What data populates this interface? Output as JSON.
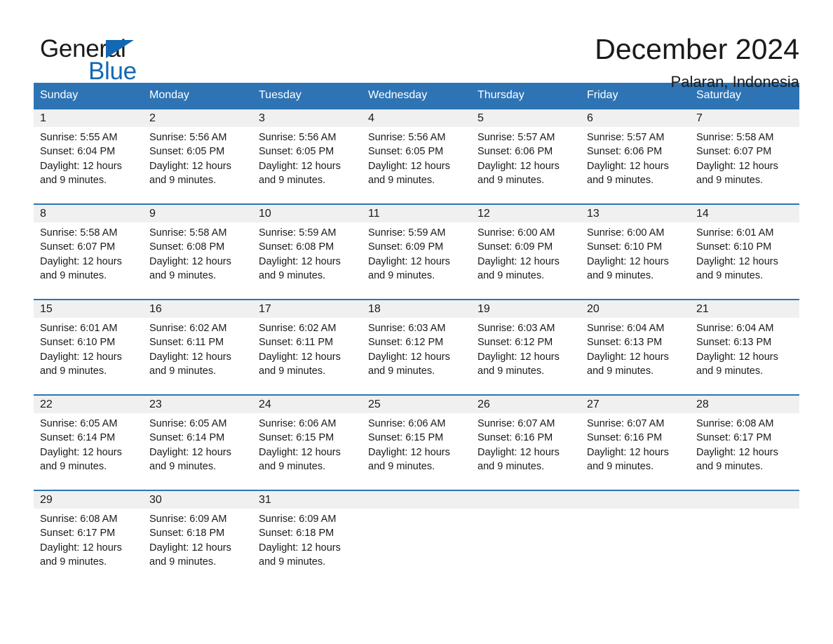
{
  "brand": {
    "name_part1": "General",
    "name_part2": "Blue",
    "logo_icon": "triangle-flag-icon"
  },
  "header": {
    "month_title": "December 2024",
    "location": "Palaran, Indonesia"
  },
  "colors": {
    "header_blue": "#2e74b5",
    "brand_blue": "#1268b3",
    "daynum_band": "#f0f0f0",
    "text": "#1a1a1a"
  },
  "calendar": {
    "weekday_headers": [
      "Sunday",
      "Monday",
      "Tuesday",
      "Wednesday",
      "Thursday",
      "Friday",
      "Saturday"
    ],
    "weeks": [
      [
        {
          "day": "1",
          "sunrise": "Sunrise: 5:55 AM",
          "sunset": "Sunset: 6:04 PM",
          "daylight1": "Daylight: 12 hours",
          "daylight2": "and 9 minutes."
        },
        {
          "day": "2",
          "sunrise": "Sunrise: 5:56 AM",
          "sunset": "Sunset: 6:05 PM",
          "daylight1": "Daylight: 12 hours",
          "daylight2": "and 9 minutes."
        },
        {
          "day": "3",
          "sunrise": "Sunrise: 5:56 AM",
          "sunset": "Sunset: 6:05 PM",
          "daylight1": "Daylight: 12 hours",
          "daylight2": "and 9 minutes."
        },
        {
          "day": "4",
          "sunrise": "Sunrise: 5:56 AM",
          "sunset": "Sunset: 6:05 PM",
          "daylight1": "Daylight: 12 hours",
          "daylight2": "and 9 minutes."
        },
        {
          "day": "5",
          "sunrise": "Sunrise: 5:57 AM",
          "sunset": "Sunset: 6:06 PM",
          "daylight1": "Daylight: 12 hours",
          "daylight2": "and 9 minutes."
        },
        {
          "day": "6",
          "sunrise": "Sunrise: 5:57 AM",
          "sunset": "Sunset: 6:06 PM",
          "daylight1": "Daylight: 12 hours",
          "daylight2": "and 9 minutes."
        },
        {
          "day": "7",
          "sunrise": "Sunrise: 5:58 AM",
          "sunset": "Sunset: 6:07 PM",
          "daylight1": "Daylight: 12 hours",
          "daylight2": "and 9 minutes."
        }
      ],
      [
        {
          "day": "8",
          "sunrise": "Sunrise: 5:58 AM",
          "sunset": "Sunset: 6:07 PM",
          "daylight1": "Daylight: 12 hours",
          "daylight2": "and 9 minutes."
        },
        {
          "day": "9",
          "sunrise": "Sunrise: 5:58 AM",
          "sunset": "Sunset: 6:08 PM",
          "daylight1": "Daylight: 12 hours",
          "daylight2": "and 9 minutes."
        },
        {
          "day": "10",
          "sunrise": "Sunrise: 5:59 AM",
          "sunset": "Sunset: 6:08 PM",
          "daylight1": "Daylight: 12 hours",
          "daylight2": "and 9 minutes."
        },
        {
          "day": "11",
          "sunrise": "Sunrise: 5:59 AM",
          "sunset": "Sunset: 6:09 PM",
          "daylight1": "Daylight: 12 hours",
          "daylight2": "and 9 minutes."
        },
        {
          "day": "12",
          "sunrise": "Sunrise: 6:00 AM",
          "sunset": "Sunset: 6:09 PM",
          "daylight1": "Daylight: 12 hours",
          "daylight2": "and 9 minutes."
        },
        {
          "day": "13",
          "sunrise": "Sunrise: 6:00 AM",
          "sunset": "Sunset: 6:10 PM",
          "daylight1": "Daylight: 12 hours",
          "daylight2": "and 9 minutes."
        },
        {
          "day": "14",
          "sunrise": "Sunrise: 6:01 AM",
          "sunset": "Sunset: 6:10 PM",
          "daylight1": "Daylight: 12 hours",
          "daylight2": "and 9 minutes."
        }
      ],
      [
        {
          "day": "15",
          "sunrise": "Sunrise: 6:01 AM",
          "sunset": "Sunset: 6:10 PM",
          "daylight1": "Daylight: 12 hours",
          "daylight2": "and 9 minutes."
        },
        {
          "day": "16",
          "sunrise": "Sunrise: 6:02 AM",
          "sunset": "Sunset: 6:11 PM",
          "daylight1": "Daylight: 12 hours",
          "daylight2": "and 9 minutes."
        },
        {
          "day": "17",
          "sunrise": "Sunrise: 6:02 AM",
          "sunset": "Sunset: 6:11 PM",
          "daylight1": "Daylight: 12 hours",
          "daylight2": "and 9 minutes."
        },
        {
          "day": "18",
          "sunrise": "Sunrise: 6:03 AM",
          "sunset": "Sunset: 6:12 PM",
          "daylight1": "Daylight: 12 hours",
          "daylight2": "and 9 minutes."
        },
        {
          "day": "19",
          "sunrise": "Sunrise: 6:03 AM",
          "sunset": "Sunset: 6:12 PM",
          "daylight1": "Daylight: 12 hours",
          "daylight2": "and 9 minutes."
        },
        {
          "day": "20",
          "sunrise": "Sunrise: 6:04 AM",
          "sunset": "Sunset: 6:13 PM",
          "daylight1": "Daylight: 12 hours",
          "daylight2": "and 9 minutes."
        },
        {
          "day": "21",
          "sunrise": "Sunrise: 6:04 AM",
          "sunset": "Sunset: 6:13 PM",
          "daylight1": "Daylight: 12 hours",
          "daylight2": "and 9 minutes."
        }
      ],
      [
        {
          "day": "22",
          "sunrise": "Sunrise: 6:05 AM",
          "sunset": "Sunset: 6:14 PM",
          "daylight1": "Daylight: 12 hours",
          "daylight2": "and 9 minutes."
        },
        {
          "day": "23",
          "sunrise": "Sunrise: 6:05 AM",
          "sunset": "Sunset: 6:14 PM",
          "daylight1": "Daylight: 12 hours",
          "daylight2": "and 9 minutes."
        },
        {
          "day": "24",
          "sunrise": "Sunrise: 6:06 AM",
          "sunset": "Sunset: 6:15 PM",
          "daylight1": "Daylight: 12 hours",
          "daylight2": "and 9 minutes."
        },
        {
          "day": "25",
          "sunrise": "Sunrise: 6:06 AM",
          "sunset": "Sunset: 6:15 PM",
          "daylight1": "Daylight: 12 hours",
          "daylight2": "and 9 minutes."
        },
        {
          "day": "26",
          "sunrise": "Sunrise: 6:07 AM",
          "sunset": "Sunset: 6:16 PM",
          "daylight1": "Daylight: 12 hours",
          "daylight2": "and 9 minutes."
        },
        {
          "day": "27",
          "sunrise": "Sunrise: 6:07 AM",
          "sunset": "Sunset: 6:16 PM",
          "daylight1": "Daylight: 12 hours",
          "daylight2": "and 9 minutes."
        },
        {
          "day": "28",
          "sunrise": "Sunrise: 6:08 AM",
          "sunset": "Sunset: 6:17 PM",
          "daylight1": "Daylight: 12 hours",
          "daylight2": "and 9 minutes."
        }
      ],
      [
        {
          "day": "29",
          "sunrise": "Sunrise: 6:08 AM",
          "sunset": "Sunset: 6:17 PM",
          "daylight1": "Daylight: 12 hours",
          "daylight2": "and 9 minutes."
        },
        {
          "day": "30",
          "sunrise": "Sunrise: 6:09 AM",
          "sunset": "Sunset: 6:18 PM",
          "daylight1": "Daylight: 12 hours",
          "daylight2": "and 9 minutes."
        },
        {
          "day": "31",
          "sunrise": "Sunrise: 6:09 AM",
          "sunset": "Sunset: 6:18 PM",
          "daylight1": "Daylight: 12 hours",
          "daylight2": "and 9 minutes."
        },
        {
          "day": "",
          "sunrise": "",
          "sunset": "",
          "daylight1": "",
          "daylight2": ""
        },
        {
          "day": "",
          "sunrise": "",
          "sunset": "",
          "daylight1": "",
          "daylight2": ""
        },
        {
          "day": "",
          "sunrise": "",
          "sunset": "",
          "daylight1": "",
          "daylight2": ""
        },
        {
          "day": "",
          "sunrise": "",
          "sunset": "",
          "daylight1": "",
          "daylight2": ""
        }
      ]
    ]
  }
}
